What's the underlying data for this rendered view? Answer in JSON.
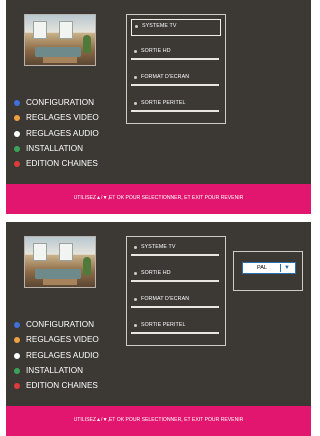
{
  "colors": {
    "background": "#3c3935",
    "footer": "#e2156f",
    "text": "#ffffff",
    "select_border": "#2a6fb0"
  },
  "screens": [
    {
      "submenu": [
        {
          "label": "SYSTEME TV",
          "selected": true
        },
        {
          "label": "SORTIE HD",
          "selected": false
        },
        {
          "label": "FORMAT D'ECRAN",
          "selected": false
        },
        {
          "label": "SORTIE PERITEL",
          "selected": false
        }
      ],
      "main_menu": [
        {
          "label": "CONFIGURATION",
          "color": "#3f6fd9",
          "icon": "blue-dot-icon"
        },
        {
          "label": "REGLAGES VIDEO",
          "color": "#f2a141",
          "icon": "orange-dot-icon"
        },
        {
          "label": "REGLAGES AUDIO",
          "color": "#ffffff",
          "icon": "white-dot-icon"
        },
        {
          "label": "INSTALLATION",
          "color": "#3ca35a",
          "icon": "green-dot-icon"
        },
        {
          "label": "EDITION CHAINES",
          "color": "#e03b3b",
          "icon": "red-dot-icon"
        }
      ],
      "footer": "UTILISEZ▲/▼,ET OK POUR SELECTIONNER, ET EXIT POUR REVENIR"
    },
    {
      "submenu": [
        {
          "label": "SYSTEME TV",
          "selected": false
        },
        {
          "label": "SORTIE HD",
          "selected": false
        },
        {
          "label": "FORMAT D'ECRAN",
          "selected": false
        },
        {
          "label": "SORTIE PERITEL",
          "selected": false
        }
      ],
      "main_menu": [
        {
          "label": "CONFIGURATION",
          "color": "#3f6fd9",
          "icon": "blue-dot-icon"
        },
        {
          "label": "REGLAGES VIDEO",
          "color": "#f2a141",
          "icon": "orange-dot-icon"
        },
        {
          "label": "REGLAGES AUDIO",
          "color": "#ffffff",
          "icon": "white-dot-icon"
        },
        {
          "label": "INSTALLATION",
          "color": "#3ca35a",
          "icon": "green-dot-icon"
        },
        {
          "label": "EDITION CHAINES",
          "color": "#e03b3b",
          "icon": "red-dot-icon"
        }
      ],
      "option": {
        "value": "PAL",
        "arrow": "▼"
      },
      "footer": "UTILISEZ▲/▼,ET OK POUR SELECTIONNER, ET EXIT POUR REVENIR"
    }
  ]
}
